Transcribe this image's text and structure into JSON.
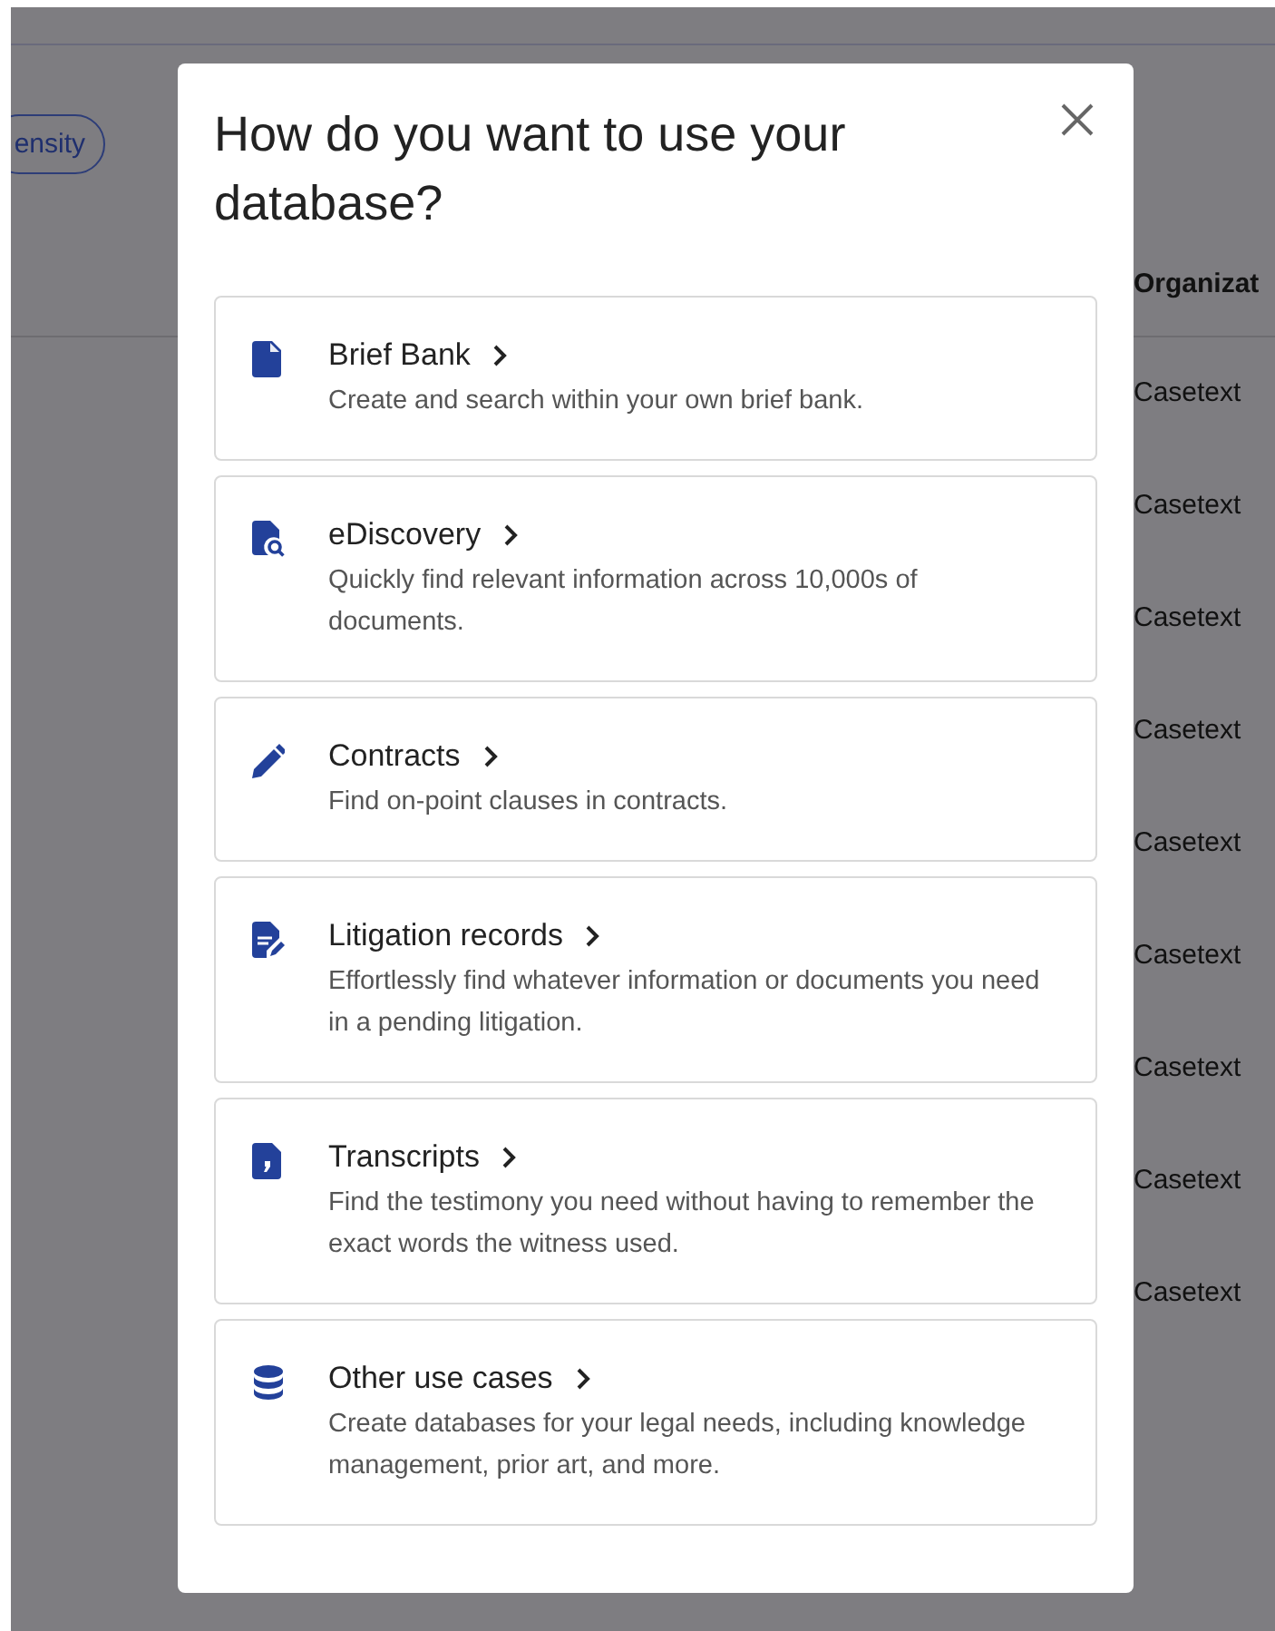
{
  "background": {
    "density_button": "ensity",
    "column_header": "Organizat",
    "rows": [
      "Casetext",
      "Casetext",
      "Casetext",
      "Casetext",
      "Casetext",
      "Casetext",
      "Casetext",
      "Casetext",
      "Casetext"
    ]
  },
  "dialog": {
    "title": "How do you want to use your database?",
    "options": [
      {
        "kind": "document",
        "title": "Brief Bank",
        "description": "Create and search within your own brief bank."
      },
      {
        "kind": "search-document",
        "title": "eDiscovery",
        "description": "Quickly find relevant information across 10,000s of documents."
      },
      {
        "kind": "pencil",
        "title": "Contracts",
        "description": "Find on-point clauses in contracts."
      },
      {
        "kind": "edit-document",
        "title": "Litigation records",
        "description": "Effortlessly find whatever information or documents you need in a pending litigation."
      },
      {
        "kind": "quote-document",
        "title": "Transcripts",
        "description": "Find the testimony you need without having to remember the exact words the witness used."
      },
      {
        "kind": "database",
        "title": "Other use cases",
        "description": "Create databases for your legal needs, including knowledge management, prior art, and more."
      }
    ]
  }
}
